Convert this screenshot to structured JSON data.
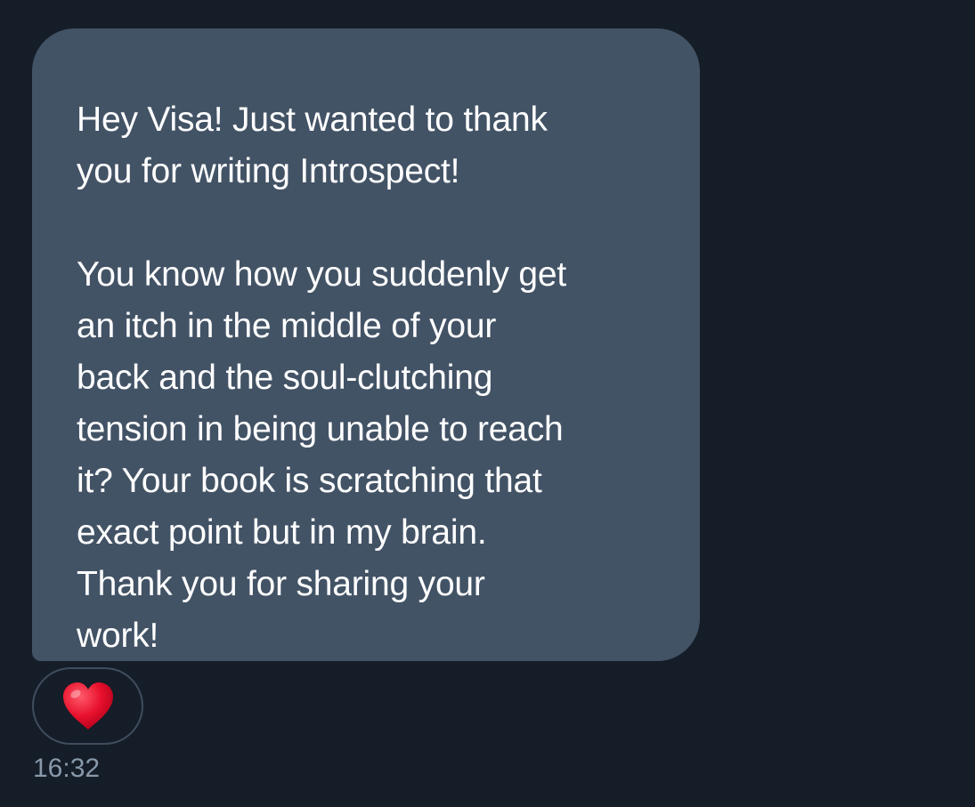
{
  "message": {
    "text": "Hey Visa! Just wanted to thank\nyou for writing Introspect!\n\nYou know how you suddenly get\nan itch in the middle of your\nback and the soul-clutching\ntension in being unable to reach\nit? Your book is scratching that\nexact point but in my brain.\nThank you for sharing your\nwork!",
    "timestamp": "16:32",
    "reaction": {
      "icon": "red-heart-icon"
    }
  },
  "colors": {
    "background": "#151d28",
    "bubble": "#435366",
    "text": "#ffffff",
    "timestamp": "#8899aa",
    "heart": "#e8112d"
  }
}
